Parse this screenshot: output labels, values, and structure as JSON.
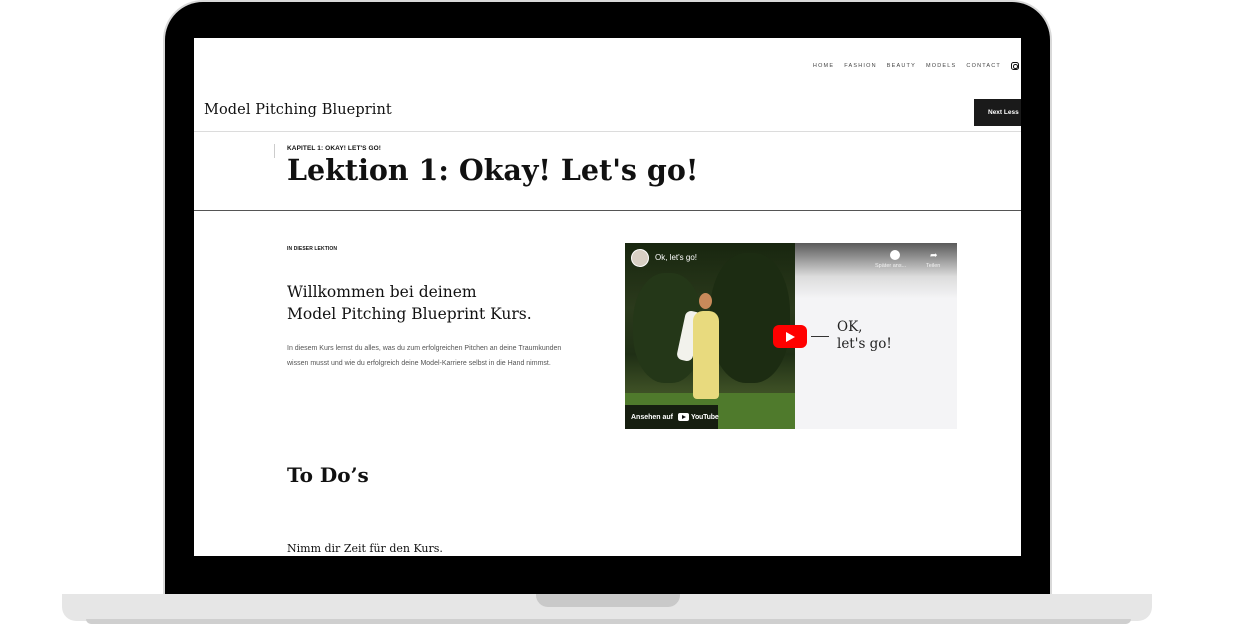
{
  "nav": {
    "items": [
      "HOME",
      "FASHION",
      "BEAUTY",
      "MODELS",
      "CONTACT"
    ],
    "instagram_icon": "instagram-icon"
  },
  "brand": "Model Pitching Blueprint",
  "next_lesson_label": "Next Less",
  "chapter_label": "KAPITEL 1: OKAY! LET'S GO!",
  "lesson_title": "Lektion 1: Okay! Let's go!",
  "in_lesson_label": "IN DIESER LEKTION",
  "welcome_line1": "Willkommen bei deinem",
  "welcome_line2": "Model Pitching Blueprint Kurs.",
  "intro_text": "In diesem Kurs lernst du alles, was du zum erfolgreichen Pitchen an deine Traumkunden wissen musst und wie du erfolgreich deine Model-Karriere selbst in die Hand nimmst.",
  "video": {
    "title": "Ok, let's go!",
    "watch_later_label": "Später ans...",
    "share_label": "Teilen",
    "overlay_line1": "OK,",
    "overlay_line2": "let's go!",
    "watch_on_label": "Ansehen auf",
    "youtube_label": "YouTube"
  },
  "todos_heading": "To Do’s",
  "todo_first": "Nimm dir Zeit für den Kurs.",
  "colors": {
    "accent": "#1a1a1a",
    "play_button": "#ff0000"
  }
}
